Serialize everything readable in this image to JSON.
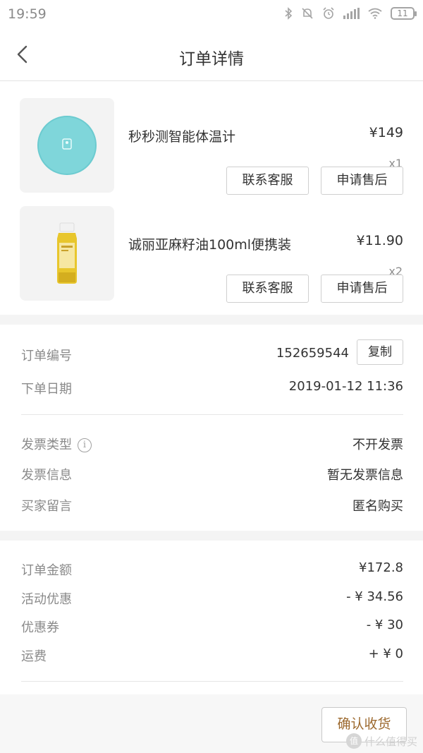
{
  "status_bar": {
    "time": "19:59",
    "battery": "11",
    "icons": [
      "bluetooth-icon",
      "mute-icon",
      "alarm-icon",
      "signal-icon",
      "wifi-icon",
      "battery-icon"
    ]
  },
  "nav": {
    "title": "订单详情",
    "back_icon": "chevron-left-icon"
  },
  "products": [
    {
      "name": "秒秒测智能体温计",
      "price": "¥149",
      "qty": "x1",
      "btn_service": "联系客服",
      "btn_after": "申请售后"
    },
    {
      "name": "诚丽亚麻籽油100ml便携装",
      "price": "¥11.90",
      "qty": "x2",
      "btn_service": "联系客服",
      "btn_after": "申请售后"
    }
  ],
  "order": {
    "no_label": "订单编号",
    "no_value": "152659544",
    "copy_label": "复制",
    "date_label": "下单日期",
    "date_value": "2019-01-12 11:36"
  },
  "invoice": {
    "type_label": "发票类型",
    "type_value": "不开发票",
    "info_label": "发票信息",
    "info_value": "暂无发票信息",
    "message_label": "买家留言",
    "message_value": "匿名购买"
  },
  "amounts": {
    "total_label": "订单金额",
    "total_value": "¥172.8",
    "promo_label": "活动优惠",
    "promo_value": "- ¥ 34.56",
    "coupon_label": "优惠券",
    "coupon_value": "- ¥ 30",
    "shipping_label": "运费",
    "shipping_value": "+ ¥ 0"
  },
  "bottom": {
    "confirm_label": "确认收货",
    "watermark": "什么值得买",
    "watermark_badge": "值"
  },
  "colors": {
    "accent": "#9d6a2f",
    "thermometer": "#7fd6da",
    "oil": "#e8c62c"
  }
}
